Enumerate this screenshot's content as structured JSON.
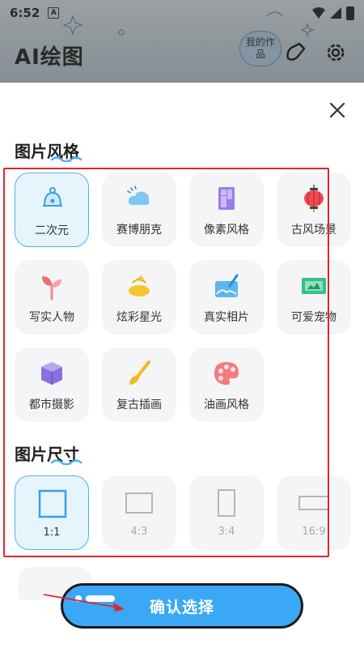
{
  "status_bar": {
    "time": "6:52",
    "notification_glyph": "A"
  },
  "app": {
    "title": "AI绘图",
    "my_works": "我的作品"
  },
  "sheet": {
    "style_section": {
      "title": "图片风格",
      "items": [
        {
          "label": "二次元",
          "icon": "anime-bell-icon",
          "selected": true
        },
        {
          "label": "赛博朋克",
          "icon": "cyber-cloud-icon",
          "selected": false
        },
        {
          "label": "像素风格",
          "icon": "pixel-panel-icon",
          "selected": false
        },
        {
          "label": "古风场景",
          "icon": "lantern-icon",
          "selected": false
        },
        {
          "label": "写实人物",
          "icon": "sprout-icon",
          "selected": false
        },
        {
          "label": "炫彩星光",
          "icon": "starlight-icon",
          "selected": false
        },
        {
          "label": "真实相片",
          "icon": "photo-brush-icon",
          "selected": false
        },
        {
          "label": "可爱宠物",
          "icon": "pet-card-icon",
          "selected": false
        },
        {
          "label": "都市摄影",
          "icon": "cube-icon",
          "selected": false
        },
        {
          "label": "复古插画",
          "icon": "paintbrush-icon",
          "selected": false
        },
        {
          "label": "油画风格",
          "icon": "palette-icon",
          "selected": false
        }
      ]
    },
    "size_section": {
      "title": "图片尺寸",
      "items": [
        {
          "label": "1:1",
          "selected": true
        },
        {
          "label": "4:3",
          "selected": false
        },
        {
          "label": "3:4",
          "selected": false
        },
        {
          "label": "16:9",
          "selected": false
        }
      ]
    },
    "confirm_label": "确认选择"
  },
  "colors": {
    "accent": "#3aa8f5",
    "selected_bg": "#e6f4fc",
    "highlight_box": "#e0262d",
    "tile_bg": "#f4f5f6"
  }
}
